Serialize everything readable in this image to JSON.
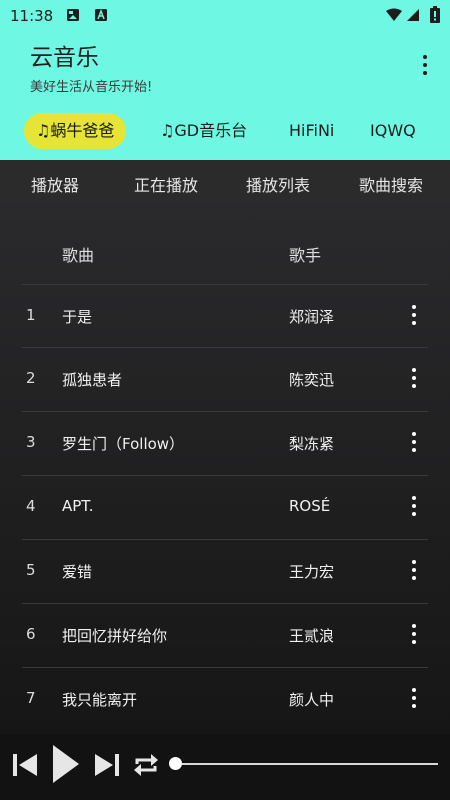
{
  "status_bar": {
    "time": "11:38",
    "icons": [
      "image-icon",
      "a-icon",
      "wifi-icon",
      "signal-icon",
      "battery-icon"
    ]
  },
  "app": {
    "title": "云音乐",
    "subtitle": "美好生活从音乐开始!"
  },
  "source_tabs": [
    {
      "label": "♫蜗牛爸爸",
      "active": true
    },
    {
      "label": "♫GD音乐台",
      "active": false
    },
    {
      "label": "HiFiNi",
      "active": false
    },
    {
      "label": "IQWQ",
      "active": false
    }
  ],
  "sub_nav": [
    "播放器",
    "正在播放",
    "播放列表",
    "歌曲搜索"
  ],
  "table": {
    "headers": {
      "song": "歌曲",
      "artist": "歌手"
    },
    "rows": [
      {
        "num": "1",
        "title": "于是",
        "artist": "郑润泽"
      },
      {
        "num": "2",
        "title": "孤独患者",
        "artist": "陈奕迅"
      },
      {
        "num": "3",
        "title": "罗生门（Follow）",
        "artist": "梨冻紧"
      },
      {
        "num": "4",
        "title": "APT.",
        "artist": "ROSÉ"
      },
      {
        "num": "5",
        "title": "爱错",
        "artist": "王力宏"
      },
      {
        "num": "6",
        "title": "把回忆拼好给你",
        "artist": "王贰浪"
      },
      {
        "num": "7",
        "title": "我只能离开",
        "artist": "颜人中"
      }
    ]
  },
  "player": {
    "progress": 0.0,
    "controls": [
      "previous-icon",
      "play-icon",
      "next-icon",
      "repeat-icon"
    ]
  },
  "colors": {
    "header_bg": "#6ef7e2",
    "active_tab_bg": "#e6e536",
    "list_bg": "#1c1c1e"
  }
}
